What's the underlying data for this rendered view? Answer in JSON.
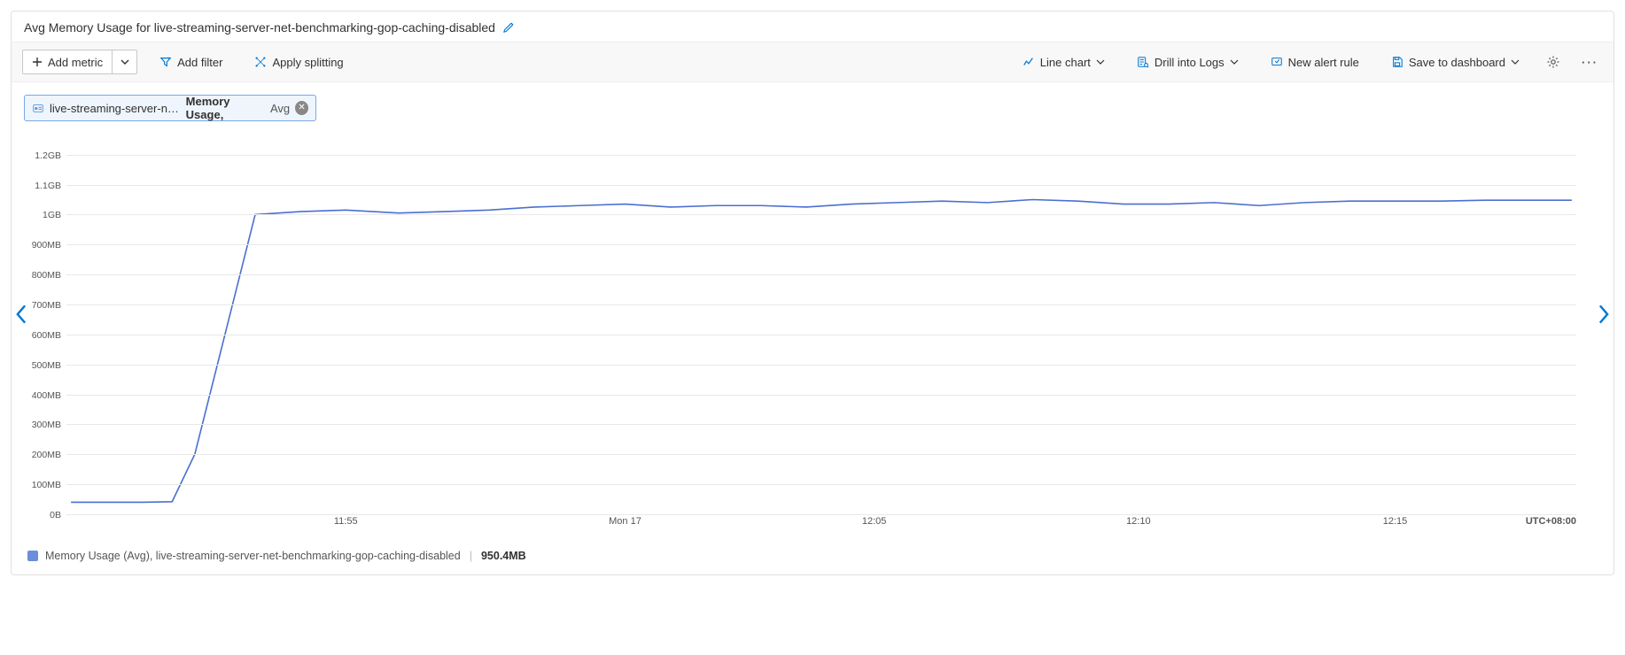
{
  "title": "Avg Memory Usage for live-streaming-server-net-benchmarking-gop-caching-disabled",
  "toolbar": {
    "add_metric": "Add metric",
    "add_filter": "Add filter",
    "apply_splitting": "Apply splitting",
    "chart_type": "Line chart",
    "drill_logs": "Drill into Logs",
    "new_alert": "New alert rule",
    "save_dashboard": "Save to dashboard"
  },
  "chip": {
    "resource": "live-streaming-server-net-...",
    "metric": "Memory Usage,",
    "aggregation": "Avg"
  },
  "legend": {
    "series_name": "Memory Usage (Avg), live-streaming-server-net-benchmarking-gop-caching-disabled",
    "value": "950.4MB"
  },
  "x_timezone": "UTC+08:00",
  "chart_data": {
    "type": "line",
    "title": "Avg Memory Usage for live-streaming-server-net-benchmarking-gop-caching-disabled",
    "xlabel": "",
    "ylabel": "",
    "y_unit": "MB",
    "y_ticks": [
      {
        "value": 0,
        "label": "0B"
      },
      {
        "value": 100,
        "label": "100MB"
      },
      {
        "value": 200,
        "label": "200MB"
      },
      {
        "value": 300,
        "label": "300MB"
      },
      {
        "value": 400,
        "label": "400MB"
      },
      {
        "value": 500,
        "label": "500MB"
      },
      {
        "value": 600,
        "label": "600MB"
      },
      {
        "value": 700,
        "label": "700MB"
      },
      {
        "value": 800,
        "label": "800MB"
      },
      {
        "value": 900,
        "label": "900MB"
      },
      {
        "value": 1000,
        "label": "1GB"
      },
      {
        "value": 1100,
        "label": "1.1GB"
      },
      {
        "value": 1200,
        "label": "1.2GB"
      }
    ],
    "ylim": [
      0,
      1270
    ],
    "xlim": [
      0,
      100
    ],
    "x_ticks": [
      {
        "pos": 18.5,
        "label": "11:55"
      },
      {
        "pos": 37.0,
        "label": "Mon 17"
      },
      {
        "pos": 53.5,
        "label": "12:05"
      },
      {
        "pos": 71.0,
        "label": "12:10"
      },
      {
        "pos": 88.0,
        "label": "12:15"
      }
    ],
    "series": [
      {
        "name": "Memory Usage (Avg)",
        "color": "#4a6fd0",
        "points": [
          {
            "x": 0.3,
            "y": 40
          },
          {
            "x": 5.0,
            "y": 40
          },
          {
            "x": 7.0,
            "y": 42
          },
          {
            "x": 8.5,
            "y": 200
          },
          {
            "x": 10.5,
            "y": 600
          },
          {
            "x": 12.5,
            "y": 1000
          },
          {
            "x": 15.5,
            "y": 1010
          },
          {
            "x": 18.5,
            "y": 1015
          },
          {
            "x": 22.0,
            "y": 1005
          },
          {
            "x": 25.0,
            "y": 1010
          },
          {
            "x": 28.0,
            "y": 1015
          },
          {
            "x": 31.0,
            "y": 1025
          },
          {
            "x": 34.0,
            "y": 1030
          },
          {
            "x": 37.0,
            "y": 1035
          },
          {
            "x": 40.0,
            "y": 1025
          },
          {
            "x": 43.0,
            "y": 1030
          },
          {
            "x": 46.0,
            "y": 1030
          },
          {
            "x": 49.0,
            "y": 1025
          },
          {
            "x": 52.0,
            "y": 1035
          },
          {
            "x": 55.0,
            "y": 1040
          },
          {
            "x": 58.0,
            "y": 1045
          },
          {
            "x": 61.0,
            "y": 1040
          },
          {
            "x": 64.0,
            "y": 1050
          },
          {
            "x": 67.0,
            "y": 1045
          },
          {
            "x": 70.0,
            "y": 1035
          },
          {
            "x": 73.0,
            "y": 1035
          },
          {
            "x": 76.0,
            "y": 1040
          },
          {
            "x": 79.0,
            "y": 1030
          },
          {
            "x": 82.0,
            "y": 1040
          },
          {
            "x": 85.0,
            "y": 1045
          },
          {
            "x": 88.0,
            "y": 1045
          },
          {
            "x": 91.0,
            "y": 1045
          },
          {
            "x": 94.0,
            "y": 1048
          },
          {
            "x": 97.0,
            "y": 1048
          },
          {
            "x": 99.7,
            "y": 1048
          }
        ]
      }
    ]
  }
}
